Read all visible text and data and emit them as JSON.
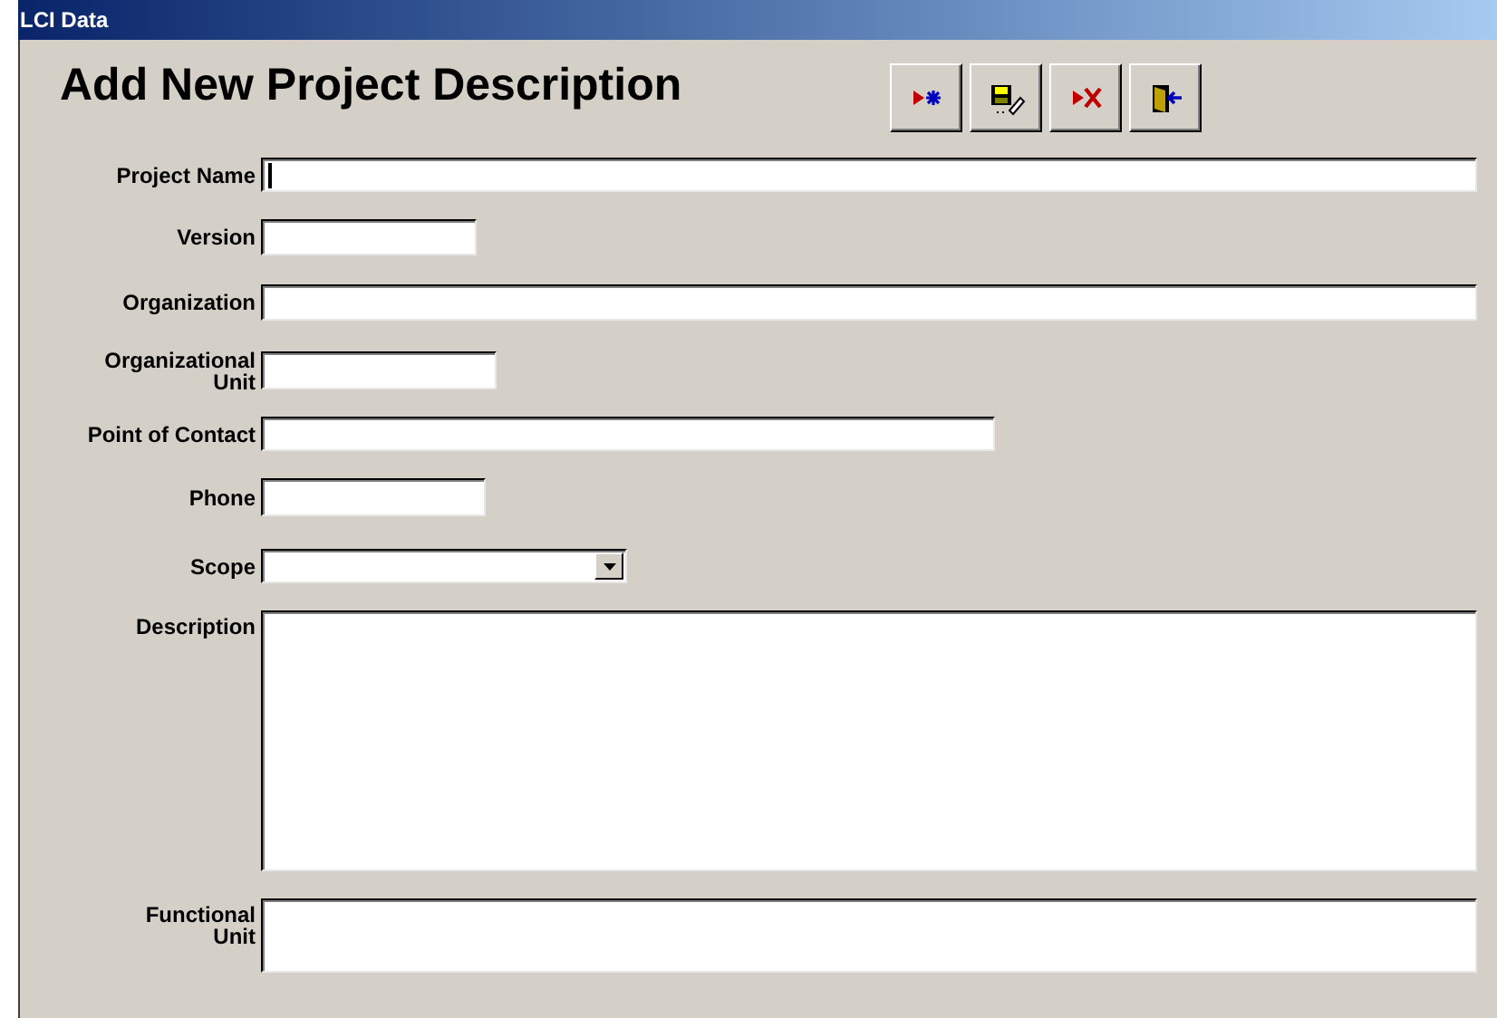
{
  "window": {
    "title": "LCI Data"
  },
  "heading": "Add New Project Description",
  "toolbar": [
    {
      "kind": "new"
    },
    {
      "kind": "save"
    },
    {
      "kind": "delete"
    },
    {
      "kind": "exit"
    }
  ],
  "fields": [
    {
      "label": "Project Name",
      "kind": "text",
      "focused": true
    },
    {
      "label": "Version",
      "kind": "text",
      "focused": false
    },
    {
      "label": "Organization",
      "kind": "text",
      "focused": false
    },
    {
      "label": "Organizational Unit",
      "kind": "text",
      "focused": false
    },
    {
      "label": "Point of Contact",
      "kind": "text",
      "focused": false
    },
    {
      "label": "Phone",
      "kind": "text",
      "focused": false
    },
    {
      "label": "Scope",
      "kind": "dropdown",
      "focused": false
    },
    {
      "label": "Description",
      "kind": "textarea",
      "focused": false
    },
    {
      "label": "Functional Unit",
      "kind": "textarea",
      "focused": false
    }
  ]
}
